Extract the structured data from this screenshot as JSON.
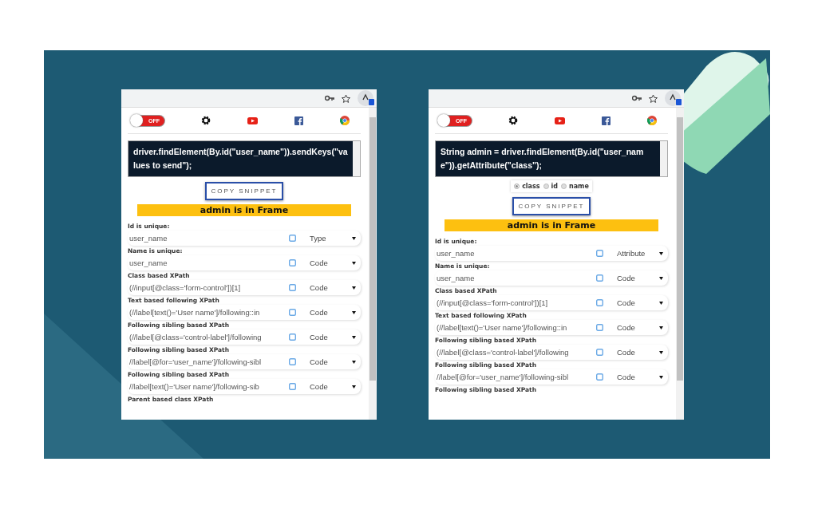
{
  "popups": [
    {
      "toggle": {
        "label": "OFF",
        "on": false
      },
      "snippet": "driver.findElement(By.id(\"user_name\")).sendKeys(\"values to send\");",
      "copy_button": "COPY SNIPPET",
      "banner": "admin is in Frame",
      "fields": [
        {
          "label": "Id is unique:",
          "value": "user_name",
          "dropdown": "Type"
        },
        {
          "label": "Name is unique:",
          "value": "user_name",
          "dropdown": "Code"
        },
        {
          "label": "Class based XPath",
          "value": "(//input[@class='form-control'])[1]",
          "dropdown": "Code"
        },
        {
          "label": "Text based following XPath",
          "value": "(//label[text()='User name']/following::in",
          "dropdown": "Code"
        },
        {
          "label": "Following sibling based XPath",
          "value": "(//label[@class='control-label']/following",
          "dropdown": "Code"
        },
        {
          "label": "Following sibling based XPath",
          "value": "//label[@for='user_name']/following-sibl",
          "dropdown": "Code"
        },
        {
          "label": "Following sibling based XPath",
          "value": "//label[text()='User name']/following-sib",
          "dropdown": "Code"
        },
        {
          "label": "Parent based class XPath"
        }
      ]
    },
    {
      "toggle": {
        "label": "OFF",
        "on": false
      },
      "snippet": "String admin = driver.findElement(By.id(\"user_name\")).getAttribute(\"class\");",
      "radios": [
        {
          "label": "class",
          "selected": true
        },
        {
          "label": "id",
          "selected": false
        },
        {
          "label": "name",
          "selected": false
        }
      ],
      "copy_button": "COPY SNIPPET",
      "banner": "admin is in Frame",
      "fields": [
        {
          "label": "Id is unique:",
          "value": "user_name",
          "dropdown": "Attribute"
        },
        {
          "label": "Name is unique:",
          "value": "user_name",
          "dropdown": "Code"
        },
        {
          "label": "Class based XPath",
          "value": "(//input[@class='form-control'])[1]",
          "dropdown": "Code"
        },
        {
          "label": "Text based following XPath",
          "value": "(//label[text()='User name']/following::in",
          "dropdown": "Code"
        },
        {
          "label": "Following sibling based XPath",
          "value": "(//label[@class='control-label']/following",
          "dropdown": "Code"
        },
        {
          "label": "Following sibling based XPath",
          "value": "//label[@for='user_name']/following-sibl",
          "dropdown": "Code"
        },
        {
          "label": "Following sibling based XPath"
        }
      ]
    }
  ]
}
